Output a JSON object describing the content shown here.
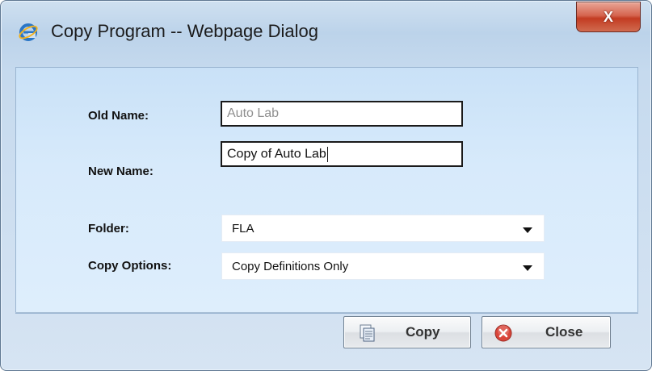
{
  "window": {
    "title": "Copy Program -- Webpage Dialog",
    "title_icon": "ie-icon",
    "close_glyph": "X"
  },
  "form": {
    "old_name": {
      "label": "Old Name:",
      "value": "Auto Lab"
    },
    "new_name": {
      "label": "New Name:",
      "value": "Copy of Auto Lab"
    },
    "folder": {
      "label": "Folder:",
      "value": "FLA"
    },
    "copy_options": {
      "label": "Copy Options:",
      "value": "Copy Definitions Only"
    }
  },
  "buttons": {
    "copy": {
      "label": "Copy",
      "icon": "copy-icon"
    },
    "close": {
      "label": "Close",
      "icon": "close-circle-icon"
    }
  },
  "colors": {
    "dialog_background": "#c6daee",
    "close_button_red": "#c33b22",
    "close_icon_red": "#d9453a"
  }
}
